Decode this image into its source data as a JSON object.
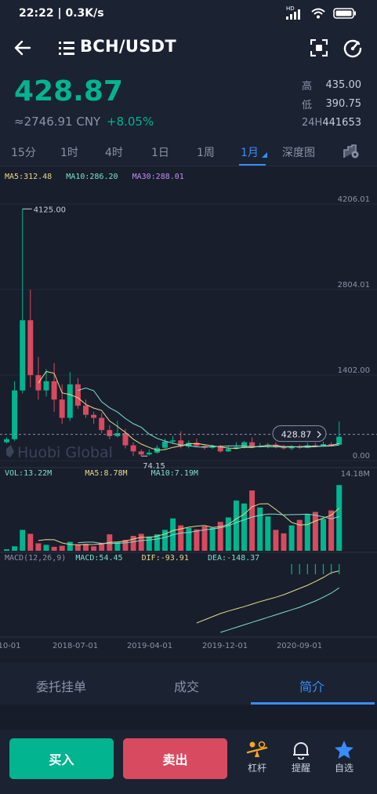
{
  "status": {
    "time": "22:22",
    "speed": "0.3K/s",
    "hd": "HD"
  },
  "header": {
    "pair": "BCH/USDT"
  },
  "price": {
    "last": "428.87",
    "cny": "≈2746.91 CNY",
    "change": "+8.05%"
  },
  "stats": [
    {
      "label": "高",
      "value": "435.00"
    },
    {
      "label": "低",
      "value": "390.75"
    },
    {
      "label": "24H",
      "value": "441653"
    }
  ],
  "tabs": [
    {
      "label": "15分"
    },
    {
      "label": "1时"
    },
    {
      "label": "4时"
    },
    {
      "label": "1日"
    },
    {
      "label": "1周"
    },
    {
      "label": "1月"
    },
    {
      "label": "深度图"
    }
  ],
  "legend": {
    "ma5": "MA5:312.48",
    "ma10": "MA10:286.20",
    "ma30": "MA30:288.01",
    "vol": "VOL:13.22M",
    "vol_ma5": "MA5:8.78M",
    "vol_ma10": "MA10:7.19M",
    "macd_params": "MACD(12,26,9)",
    "macd": "MACD:54.45",
    "dif": "DIF:-93.91",
    "dea": "DEA:-148.37"
  },
  "watermark": "Huobi Global",
  "price_badge": "428.87",
  "colors": {
    "up": "#02b48f",
    "down": "#d84a5f",
    "accent": "#3a8df8",
    "ma5": "#e8d98a",
    "ma10": "#7fdfd0",
    "ma30": "#c28ff0"
  },
  "chart_data": {
    "type": "candlestick",
    "y_axis_labels": [
      "4206.01",
      "2804.01",
      "1402.00",
      "0.00"
    ],
    "volume_max_label": "14.18M",
    "annotations": {
      "high": "4125.00",
      "low": "74.15"
    },
    "x_labels": [
      "10-01",
      "2018-07-01",
      "2019-04-01",
      "2019-12-01",
      "2020-09-01"
    ],
    "candles": [
      {
        "o": 300,
        "c": 350,
        "h": 380,
        "l": 280
      },
      {
        "o": 350,
        "c": 1150,
        "h": 1300,
        "l": 320
      },
      {
        "o": 1150,
        "c": 2300,
        "h": 4125,
        "l": 1100
      },
      {
        "o": 2300,
        "c": 1400,
        "h": 2800,
        "l": 1200
      },
      {
        "o": 1400,
        "c": 1150,
        "h": 1700,
        "l": 1000
      },
      {
        "o": 1150,
        "c": 1300,
        "h": 1500,
        "l": 1050
      },
      {
        "o": 1300,
        "c": 1000,
        "h": 1600,
        "l": 800
      },
      {
        "o": 1000,
        "c": 700,
        "h": 1250,
        "l": 600
      },
      {
        "o": 700,
        "c": 1250,
        "h": 1450,
        "l": 650
      },
      {
        "o": 1250,
        "c": 900,
        "h": 1350,
        "l": 850
      },
      {
        "o": 900,
        "c": 750,
        "h": 1000,
        "l": 700
      },
      {
        "o": 750,
        "c": 700,
        "h": 800,
        "l": 600
      },
      {
        "o": 700,
        "c": 500,
        "h": 780,
        "l": 450
      },
      {
        "o": 500,
        "c": 400,
        "h": 580,
        "l": 350
      },
      {
        "o": 400,
        "c": 450,
        "h": 650,
        "l": 380
      },
      {
        "o": 450,
        "c": 250,
        "h": 520,
        "l": 200
      },
      {
        "o": 250,
        "c": 150,
        "h": 300,
        "l": 74
      },
      {
        "o": 150,
        "c": 100,
        "h": 180,
        "l": 74
      },
      {
        "o": 100,
        "c": 130,
        "h": 180,
        "l": 80
      },
      {
        "o": 130,
        "c": 210,
        "h": 250,
        "l": 110
      },
      {
        "o": 210,
        "c": 310,
        "h": 360,
        "l": 190
      },
      {
        "o": 310,
        "c": 330,
        "h": 400,
        "l": 270
      },
      {
        "o": 330,
        "c": 230,
        "h": 480,
        "l": 200
      },
      {
        "o": 230,
        "c": 290,
        "h": 330,
        "l": 200
      },
      {
        "o": 290,
        "c": 240,
        "h": 360,
        "l": 220
      },
      {
        "o": 240,
        "c": 210,
        "h": 260,
        "l": 180
      },
      {
        "o": 210,
        "c": 230,
        "h": 260,
        "l": 190
      },
      {
        "o": 230,
        "c": 150,
        "h": 260,
        "l": 130
      },
      {
        "o": 150,
        "c": 190,
        "h": 240,
        "l": 140
      },
      {
        "o": 190,
        "c": 220,
        "h": 300,
        "l": 180
      },
      {
        "o": 220,
        "c": 300,
        "h": 320,
        "l": 200
      },
      {
        "o": 300,
        "c": 220,
        "h": 380,
        "l": 200
      },
      {
        "o": 220,
        "c": 240,
        "h": 290,
        "l": 210
      },
      {
        "o": 240,
        "c": 260,
        "h": 290,
        "l": 200
      },
      {
        "o": 260,
        "c": 220,
        "h": 300,
        "l": 200
      },
      {
        "o": 220,
        "c": 200,
        "h": 260,
        "l": 180
      },
      {
        "o": 200,
        "c": 230,
        "h": 250,
        "l": 170
      },
      {
        "o": 230,
        "c": 210,
        "h": 260,
        "l": 190
      },
      {
        "o": 210,
        "c": 250,
        "h": 290,
        "l": 200
      },
      {
        "o": 250,
        "c": 240,
        "h": 290,
        "l": 220
      },
      {
        "o": 240,
        "c": 270,
        "h": 310,
        "l": 230
      },
      {
        "o": 270,
        "c": 260,
        "h": 300,
        "l": 240
      },
      {
        "o": 260,
        "c": 390,
        "h": 640,
        "l": 250
      }
    ],
    "volume": [
      0.3,
      0.9,
      4.2,
      3.4,
      1.5,
      1.2,
      0.8,
      1.0,
      1.8,
      1.2,
      1.4,
      0.9,
      1.6,
      3.3,
      1.7,
      2.2,
      3.0,
      3.4,
      2.9,
      3.3,
      4.2,
      6.5,
      5.1,
      4.6,
      4.3,
      4.9,
      4.6,
      5.8,
      6.7,
      10.1,
      9.5,
      12.1,
      8.7,
      6.9,
      4.2,
      3.5,
      5.1,
      6.2,
      7.3,
      7.8,
      6.4,
      8.1,
      13.2
    ],
    "macd_dif": [
      -260,
      -250,
      -240,
      -230,
      -222,
      -215,
      -208,
      -200,
      -192,
      -185,
      -178,
      -170,
      -160,
      -150,
      -140,
      -128,
      -115,
      -100,
      -94
    ],
    "macd_dea": [
      -290,
      -282,
      -274,
      -266,
      -258,
      -250,
      -242,
      -234,
      -226,
      -218,
      -210,
      -200,
      -190,
      -178,
      -165,
      -148
    ]
  },
  "bottom_tabs": [
    {
      "label": "委托挂单"
    },
    {
      "label": "成交"
    },
    {
      "label": "简介"
    }
  ],
  "actions": {
    "buy": "买入",
    "sell": "卖出",
    "leverage": "杠杆",
    "alert": "提醒",
    "favorite": "自选"
  }
}
